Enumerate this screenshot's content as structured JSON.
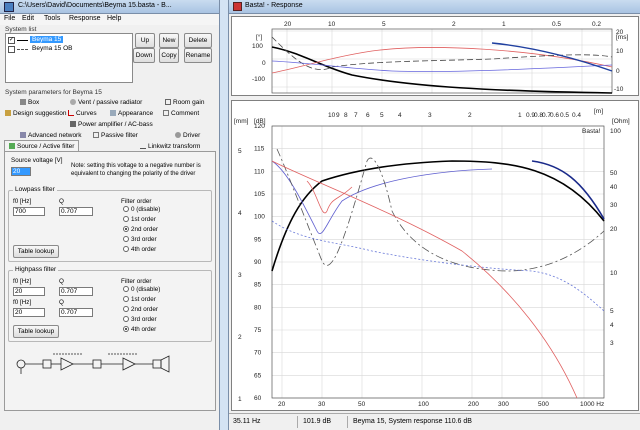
{
  "left_window": {
    "title": "C:\\Users\\David\\Documents\\Beyma 15.basta - B...",
    "menu": [
      "File",
      "Edit",
      "Tools",
      "Response",
      "Help"
    ],
    "system_list": {
      "label": "System list",
      "items": [
        {
          "name": "Beyma 15",
          "checked": "✓",
          "selected": true
        },
        {
          "name": "Beyma 15 OB",
          "checked": "",
          "selected": false
        }
      ],
      "buttons": {
        "up": "Up",
        "new": "New",
        "delete": "Delete",
        "down": "Down",
        "copy": "Copy",
        "rename": "Rename"
      }
    },
    "params_label": "System parameters for Beyma 15",
    "tabs": {
      "row1": [
        "Box",
        "Vent / passive radiator",
        "Room gain"
      ],
      "row2": [
        "Design suggestion",
        "Curves",
        "Appearance",
        "Comment"
      ],
      "row3": [
        "Power amplifier / AC-bass"
      ],
      "row4": [
        "Advanced network",
        "Passive filter",
        "Driver"
      ],
      "row5": [
        "Source / Active filter",
        "Linkwitz transform"
      ]
    },
    "source_voltage": {
      "label": "Source voltage [V]",
      "value": "20",
      "note_line1": "Note: setting this voltage to a negative number is",
      "note_line2": "equivalent to changing the polarity of the driver"
    },
    "lowpass": {
      "title": "Lowpass filter",
      "f0_label": "f0 [Hz]",
      "q_label": "Q",
      "f0_value": "700",
      "q_value": "0.707",
      "table_lookup": "Table lookup",
      "order_title": "Filter order",
      "orders": [
        "0 (disable)",
        "1st order",
        "2nd order",
        "3rd order",
        "4th order"
      ],
      "selected_index": 2
    },
    "highpass": {
      "title": "Highpass filter",
      "f0_label": "f0 [Hz]",
      "q_label": "Q",
      "f0_value_1": "20",
      "q_value_1": "0.707",
      "f0_value_2": "20",
      "q_value_2": "0.707",
      "table_lookup": "Table lookup",
      "order_title": "Filter order",
      "orders": [
        "0 (disable)",
        "1st order",
        "2nd order",
        "3rd order",
        "4th order"
      ],
      "selected_index": 4
    }
  },
  "right_window": {
    "title": "Basta! - Response",
    "top_plot": {
      "unit_left": "[°]",
      "unit_right": "[ms]",
      "left_ticks": [
        "100",
        "0",
        "-100"
      ],
      "right_ticks": [
        "20",
        "10",
        "0",
        "-10"
      ],
      "top_ticks": [
        "20",
        "10",
        "5",
        "2",
        "1",
        "0.5",
        "0.2"
      ]
    },
    "main_plot": {
      "unit_left_top": "[mm]",
      "unit_left": "[dB]",
      "unit_right": "[Ohm]",
      "unit_top": "[m]",
      "brand": "Basta!",
      "db_ticks": [
        "120",
        "115",
        "110",
        "105",
        "100",
        "95",
        "90",
        "85",
        "80",
        "75",
        "70",
        "65",
        "60"
      ],
      "mm_ticks": [
        "5",
        "4",
        "3",
        "2",
        "1"
      ],
      "ohm_ticks": [
        "100",
        "50",
        "40",
        "30",
        "20",
        "10",
        "5",
        "4",
        "3"
      ],
      "top_ticks": [
        "10",
        "9",
        "8",
        "7",
        "6",
        "5",
        "4",
        "3",
        "2",
        "1",
        "0.9",
        "0.8",
        "0.7",
        "0.6",
        "0.5",
        "0.4"
      ],
      "freq_ticks": [
        "20",
        "30",
        "50",
        "100",
        "200",
        "300",
        "500",
        "1000 Hz"
      ]
    },
    "status": {
      "freq": "35.11 Hz",
      "level": "101.9 dB",
      "message": "Beyma 15, System response 110.6 dB"
    }
  }
}
